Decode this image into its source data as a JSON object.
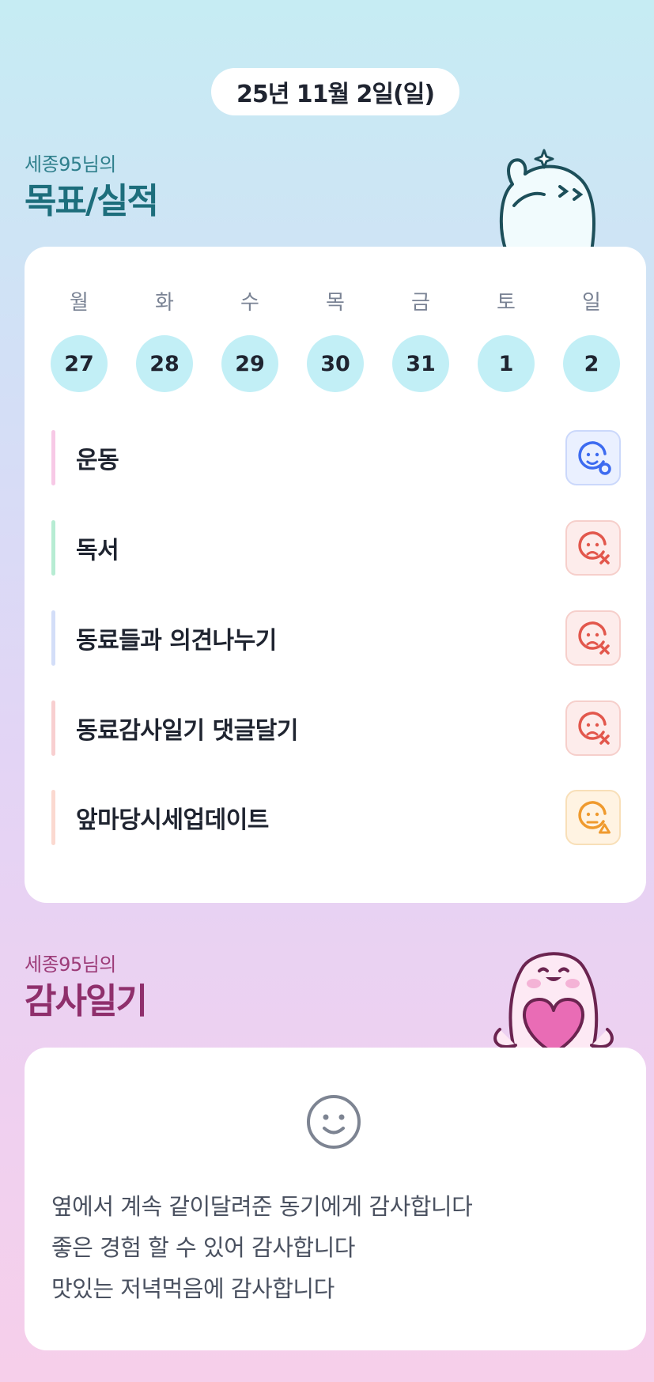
{
  "header": {
    "date": "25년 11월 2일(일)"
  },
  "goals_section": {
    "subtitle": "세종95님의",
    "title": "목표/실적",
    "weekdays": [
      "월",
      "화",
      "수",
      "목",
      "금",
      "토",
      "일"
    ],
    "day_numbers": [
      "27",
      "28",
      "29",
      "30",
      "31",
      "1",
      "2"
    ],
    "goals": [
      {
        "label": "운동",
        "bar_color": "#f7c9e6",
        "status": "achieved",
        "status_icon": "smile-check-icon"
      },
      {
        "label": "독서",
        "bar_color": "#b7ecd3",
        "status": "failed",
        "status_icon": "frown-x-icon"
      },
      {
        "label": "동료들과 의견나누기",
        "bar_color": "#d3def8",
        "status": "failed",
        "status_icon": "frown-x-icon"
      },
      {
        "label": "동료감사일기 댓글달기",
        "bar_color": "#f8cfd0",
        "status": "failed",
        "status_icon": "frown-x-icon"
      },
      {
        "label": "앞마당시세업데이트",
        "bar_color": "#fbd9d0",
        "status": "partial",
        "status_icon": "neutral-warning-icon"
      }
    ]
  },
  "gratitude_section": {
    "subtitle": "세종95님의",
    "title": "감사일기",
    "icon": "smile-icon",
    "lines": [
      "옆에서 계속 같이달려준 동기에게 감사합니다",
      "좋은 경험 할 수 있어 감사합니다",
      "맛있는 저녁먹음에 감사합니다"
    ]
  },
  "colors": {
    "good": "#3d6bf0",
    "bad": "#e2574c",
    "warn": "#ef9a2e",
    "day_circle": "#c2eff6"
  }
}
